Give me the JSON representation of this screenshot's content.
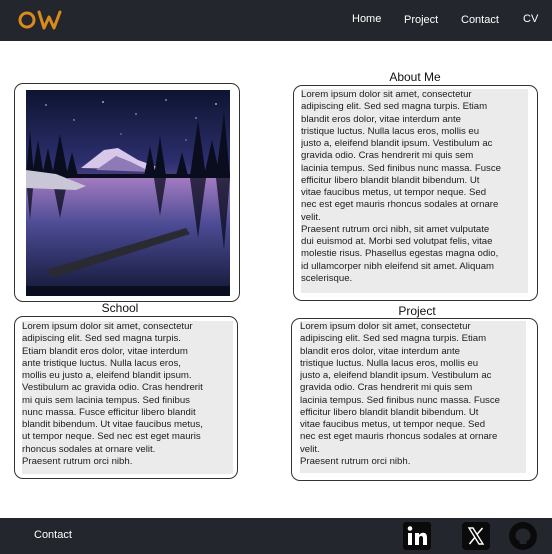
{
  "header": {
    "logo_text": "OW",
    "nav": [
      "Home",
      "Project",
      "Contact",
      "CV"
    ]
  },
  "about": {
    "heading": "About Me",
    "text": "Lorem ipsum dolor sit amet, consectetur\nadipiscing elit. Sed sed magna turpis. Etiam\nblandit eros dolor, vitae interdum ante\ntristique luctus. Nulla lacus eros, mollis eu\njusto a, eleifend blandit ipsum. Vestibulum ac\ngravida odio. Cras hendrerit mi quis sem\nlacinia tempus. Sed finibus nunc massa. Fusce\nefficitur libero blandit blandit bibendum. Ut\nvitae faucibus metus, ut tempor neque. Sed\nnec est eget mauris rhoncus sodales at ornare\nvelit.\nPraesent rutrum orci nibh, sit amet vulputate\ndui euismod at. Morbi sed volutpat felis, vitae\nmolestie risus. Phasellus egestas magna odio,\nid ullamcorper nibh eleifend sit amet. Aliquam\nscelerisque."
  },
  "school": {
    "heading": "School",
    "text": "Lorem ipsum dolor sit amet, consectetur\nadipiscing elit. Sed sed magna turpis.\nEtiam blandit eros dolor, vitae interdum\nante tristique luctus. Nulla lacus eros,\nmollis eu justo a, eleifend blandit ipsum.\nVestibulum ac gravida odio. Cras hendrerit\nmi quis sem lacinia tempus. Sed finibus\nnunc massa. Fusce efficitur libero blandit\nblandit bibendum. Ut vitae faucibus metus,\nut tempor neque. Sed nec est eget mauris\nrhoncus sodales at ornare velit.\nPraesent rutrum orci nibh."
  },
  "project": {
    "heading": "Project",
    "text": "Lorem ipsum dolor sit amet, consectetur\nadipiscing elit. Sed sed magna turpis. Etiam\nblandit eros dolor, vitae interdum ante\ntristique luctus. Nulla lacus eros, mollis eu\njusto a, eleifend blandit ipsum. Vestibulum ac\ngravida odio. Cras hendrerit mi quis sem\nlacinia tempus. Sed finibus nunc massa. Fusce\nefficitur libero blandit blandit bibendum. Ut\nvitae faucibus metus, ut tempor neque. Sed\nnec est eget mauris rhoncus sodales at ornare\nvelit.\nPraesent rutrum orci nibh."
  },
  "footer": {
    "contact": "Contact",
    "social_icons": [
      "linkedin-icon",
      "x-icon",
      "github-icon"
    ]
  },
  "colors": {
    "bar": "#23272d",
    "logo": "#d98a1b",
    "textbox": "#ebebeb"
  }
}
